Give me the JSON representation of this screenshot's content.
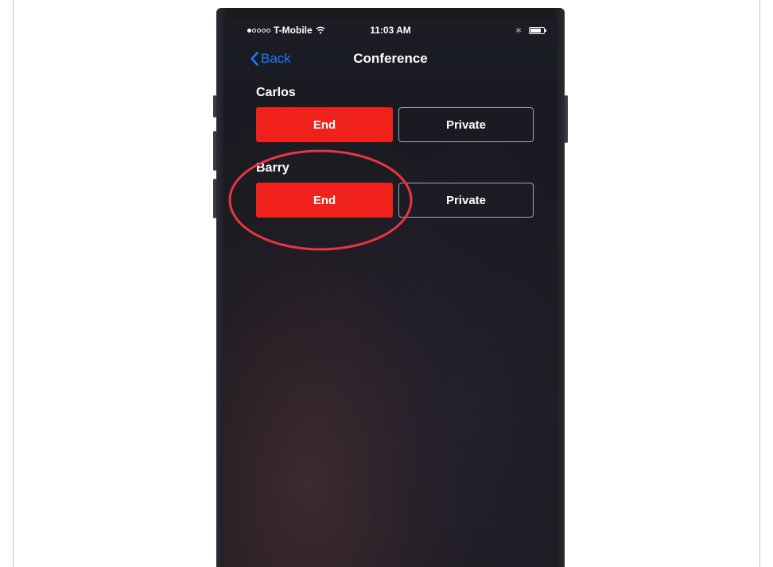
{
  "status_bar": {
    "carrier": "T-Mobile",
    "time": "11:03 AM",
    "signal_strength": "1 of 5"
  },
  "nav": {
    "back_label": "Back",
    "title": "Conference"
  },
  "participants": [
    {
      "name": "Carlos",
      "end_label": "End",
      "private_label": "Private"
    },
    {
      "name": "Barry",
      "end_label": "End",
      "private_label": "Private"
    }
  ],
  "colors": {
    "end_button": "#f0211a",
    "back_link": "#1b7cf4",
    "highlight_circle": "#e8363f"
  },
  "icons": [
    "chevron-left-icon",
    "wifi-icon",
    "bluetooth-icon",
    "battery-icon"
  ]
}
